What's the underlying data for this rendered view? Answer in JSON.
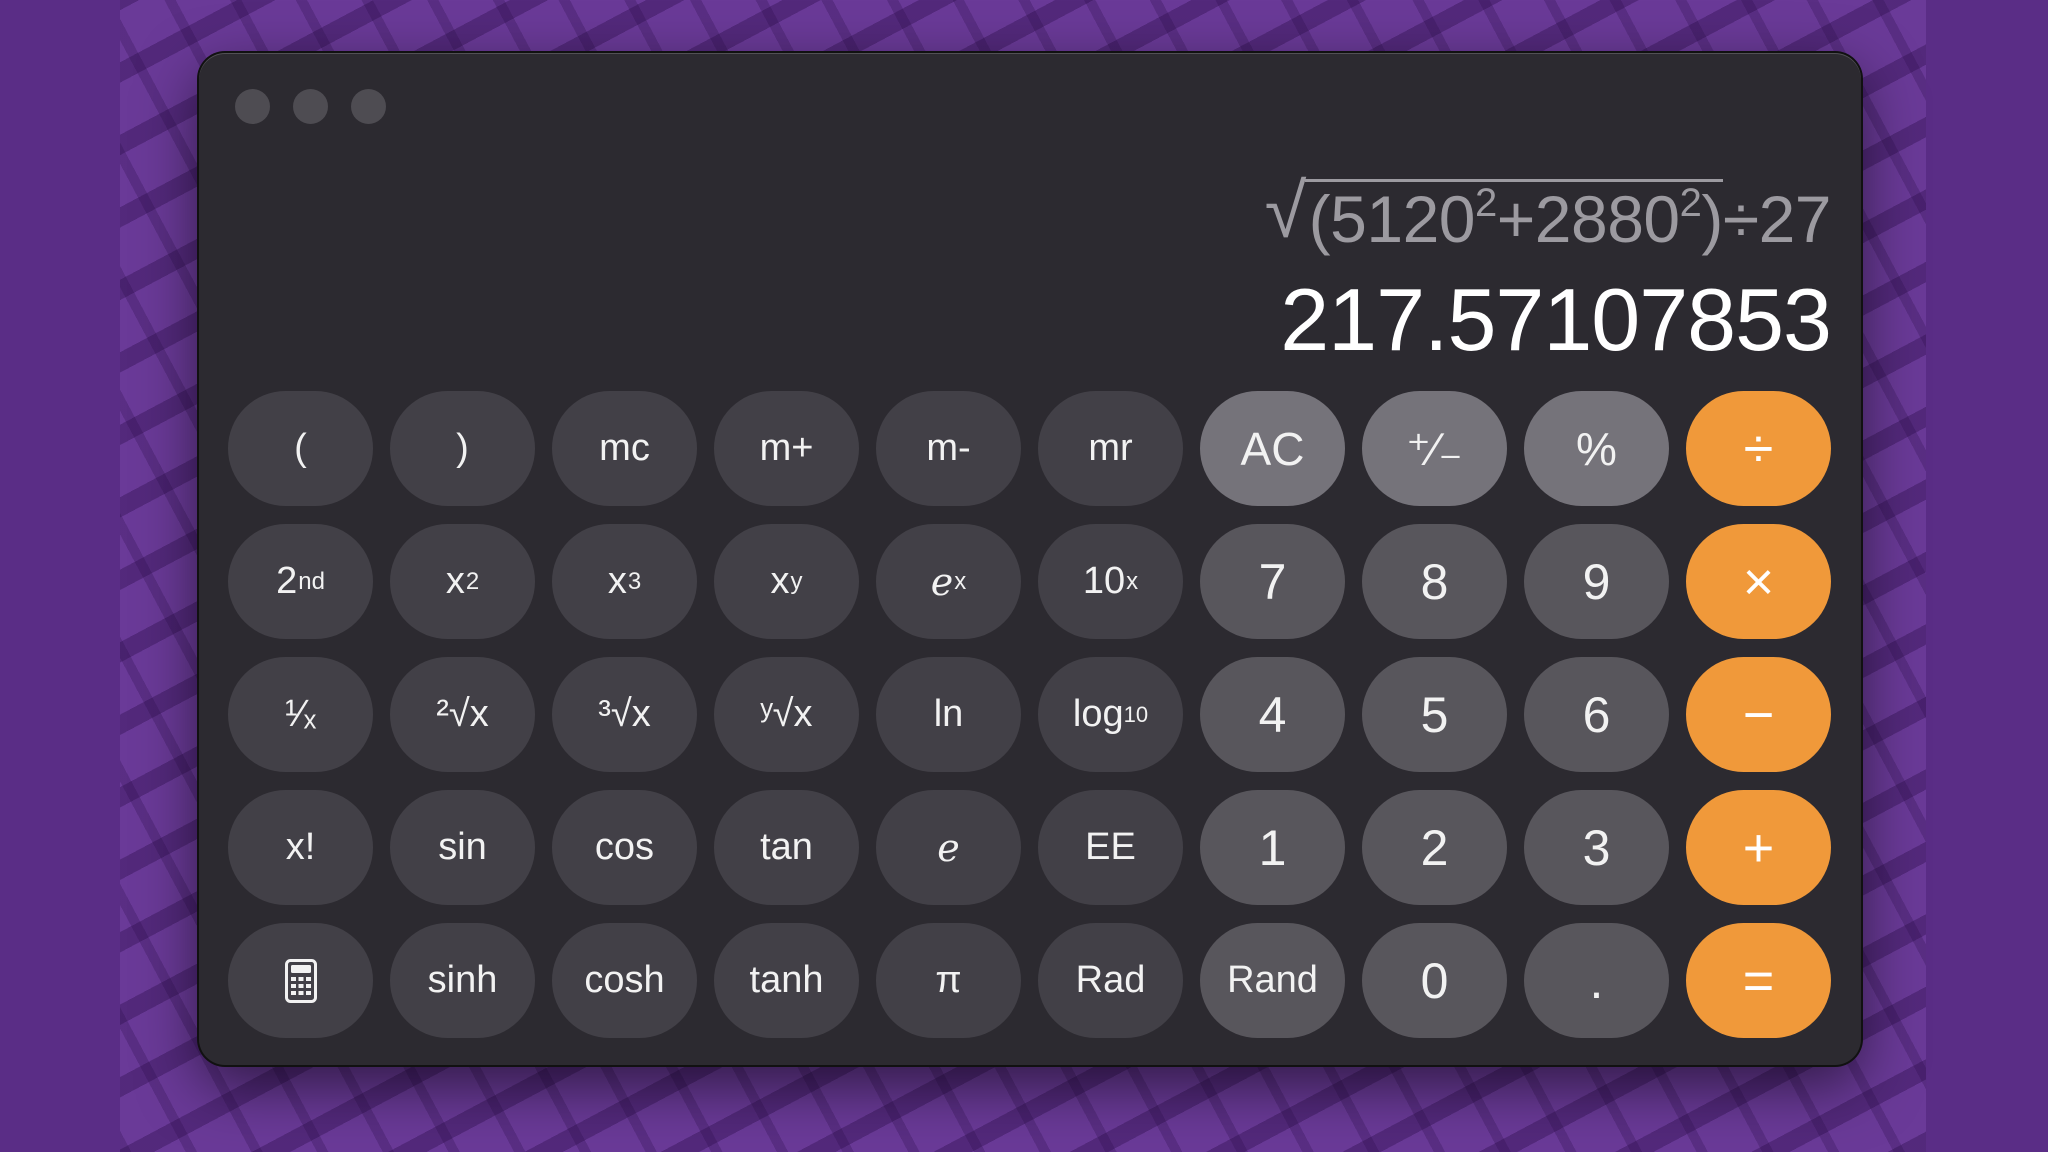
{
  "window": {
    "controls": [
      "close",
      "minimize",
      "zoom"
    ]
  },
  "display": {
    "expression_parts": {
      "base1": "5120",
      "base2": "2880",
      "exp": "2",
      "divisor": "27"
    },
    "result": "217.57107853"
  },
  "keys": {
    "row1": [
      "(",
      ")",
      "mc",
      "m+",
      "m-",
      "mr",
      "AC",
      "⁺∕₋",
      "%",
      "÷"
    ],
    "row2": {
      "second": "2",
      "second_sup": "nd",
      "x2": "x",
      "x2_sup": "2",
      "x3": "x",
      "x3_sup": "3",
      "xy": "x",
      "xy_sup": "y",
      "ex": "e",
      "ex_sup": "x",
      "tenx": "10",
      "tenx_sup": "x",
      "n7": "7",
      "n8": "8",
      "n9": "9",
      "mul": "×"
    },
    "row3": {
      "recip": "¹∕ₓ",
      "sqrt2": "²√x",
      "sqrt3": "³√x",
      "sqrty": "ʸ√x",
      "ln": "ln",
      "log": "log",
      "log_sub": "10",
      "n4": "4",
      "n5": "5",
      "n6": "6",
      "minus": "−"
    },
    "row4": {
      "fact": "x!",
      "sin": "sin",
      "cos": "cos",
      "tan": "tan",
      "e": "e",
      "ee": "EE",
      "n1": "1",
      "n2": "2",
      "n3": "3",
      "plus": "+"
    },
    "row5": {
      "calc_icon": "calculator-icon",
      "sinh": "sinh",
      "cosh": "cosh",
      "tanh": "tanh",
      "pi": "π",
      "rad": "Rad",
      "rand": "Rand",
      "n0": "0",
      "dot": ".",
      "eq": "="
    }
  },
  "colors": {
    "operator": "#f0993a",
    "function_key": "#424047",
    "number_key": "#58565c",
    "top_key": "#75737a",
    "window": "#2c2a30"
  }
}
